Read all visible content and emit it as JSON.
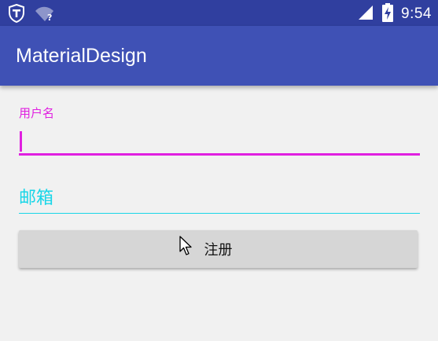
{
  "status_bar": {
    "time": "9:54",
    "icons": [
      "shield-app-icon",
      "wifi-unknown-icon",
      "signal-icon",
      "battery-charging-icon"
    ],
    "background": "#303f9f"
  },
  "app_bar": {
    "title": "MaterialDesign",
    "background": "#3f51b5"
  },
  "form": {
    "username": {
      "label": "用户名",
      "value": "",
      "accent": "#e020e0"
    },
    "email": {
      "placeholder": "邮箱",
      "value": "",
      "accent": "#19d6e8"
    },
    "register_label": "注册"
  }
}
